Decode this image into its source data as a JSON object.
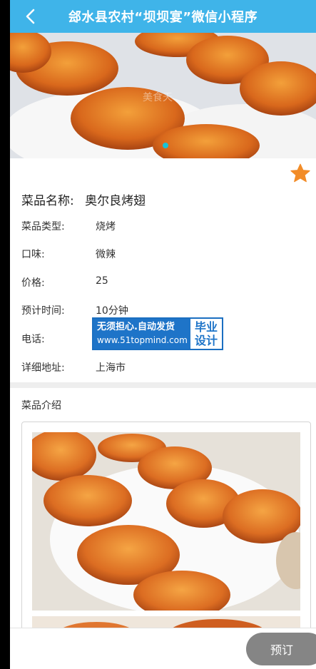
{
  "header": {
    "title": "郐水县农村“坝坝宴”微信小程序",
    "back_icon": "chevron-left-icon"
  },
  "banner": {
    "watermark": "美食天",
    "indicator_active": 1,
    "indicator_count": 1
  },
  "favorite": {
    "icon": "star-icon",
    "color": "#f28c28"
  },
  "dish": {
    "name_label": "菜品名称:",
    "name_value": "奥尔良烤翅",
    "fields": [
      {
        "label": "菜品类型:",
        "value": "烧烤"
      },
      {
        "label": "口味:",
        "value": "微辣"
      },
      {
        "label": "价格:",
        "value": "25"
      },
      {
        "label": "预计时间:",
        "value": "10分钟"
      },
      {
        "label": "电话:",
        "value": ""
      },
      {
        "label": "详细地址:",
        "value": "上海市"
      }
    ]
  },
  "ad_badge": {
    "line1": "无须担心.自动发货",
    "line2": "www.51topmind.com",
    "right_line1": "毕业",
    "right_line2": "设计"
  },
  "intro": {
    "label": "菜品介绍"
  },
  "bottom": {
    "book_label": "预订"
  },
  "colors": {
    "header": "#3fb4e9",
    "button": "#858585",
    "ad_blue": "#1e74c8"
  }
}
